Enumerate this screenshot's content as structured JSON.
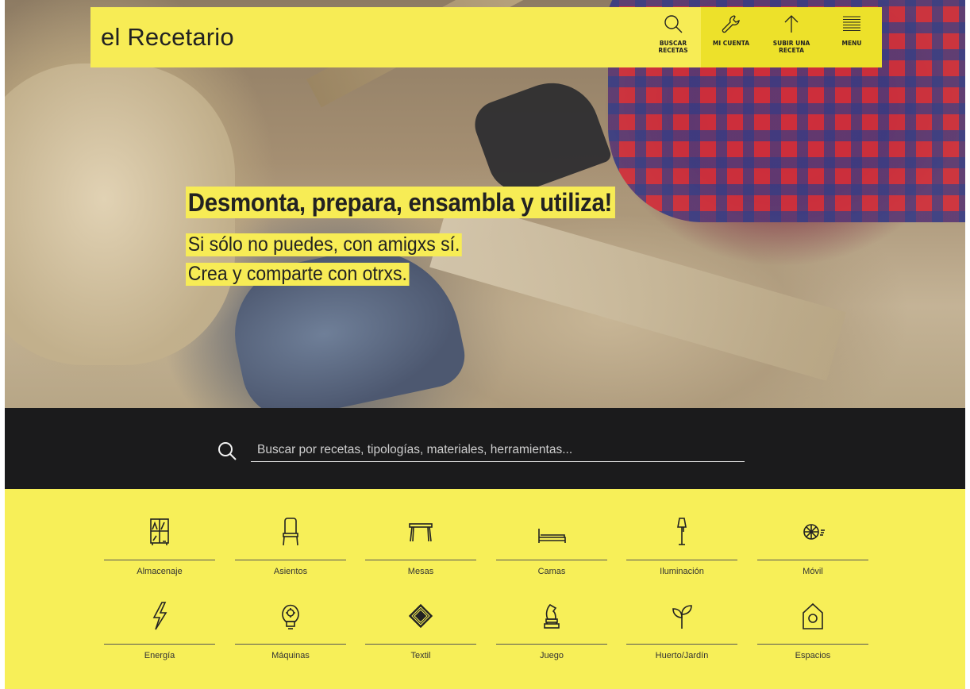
{
  "header": {
    "brand": "el Recetario",
    "nav": [
      {
        "label": "BUSCAR RECETAS",
        "icon": "search-icon"
      },
      {
        "label": "MI CUENTA",
        "icon": "wrench-icon"
      },
      {
        "label": "SUBIR UNA RECETA",
        "icon": "arrow-up-icon"
      },
      {
        "label": "MENU",
        "icon": "hamburger-icon"
      }
    ]
  },
  "hero": {
    "headline": "Desmonta, prepara, ensambla y utiliza!",
    "subline1": "Si sólo no puedes, con amigxs sí.",
    "subline2": "Crea y comparte con otrxs."
  },
  "search": {
    "placeholder": "Buscar por recetas, tipologías, materiales, herramientas...",
    "value": ""
  },
  "categories": [
    {
      "label": "Almacenaje",
      "icon": "shelf-icon"
    },
    {
      "label": "Asientos",
      "icon": "chair-icon"
    },
    {
      "label": "Mesas",
      "icon": "table-icon"
    },
    {
      "label": "Camas",
      "icon": "bed-icon"
    },
    {
      "label": "Iluminación",
      "icon": "lamp-icon"
    },
    {
      "label": "Móvil",
      "icon": "wheel-icon"
    },
    {
      "label": "Energía",
      "icon": "lightning-icon"
    },
    {
      "label": "Máquinas",
      "icon": "lightbulb-icon"
    },
    {
      "label": "Textil",
      "icon": "rug-icon"
    },
    {
      "label": "Juego",
      "icon": "chess-piece-icon"
    },
    {
      "label": "Huerto/Jardín",
      "icon": "sprout-icon"
    },
    {
      "label": "Espacios",
      "icon": "house-icon"
    }
  ],
  "colors": {
    "accent_yellow": "#f7ec55",
    "nav_dark_yellow": "#ede12a",
    "search_band": "#1b1b1c"
  }
}
